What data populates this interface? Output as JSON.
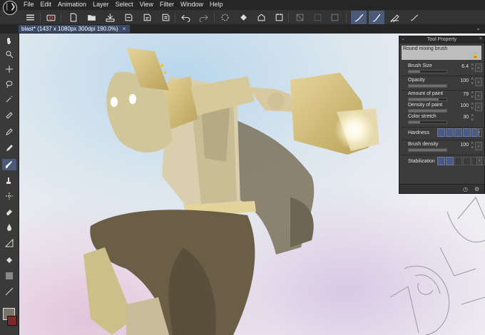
{
  "app": {
    "logo_glyph": "❘❯"
  },
  "menu": [
    "File",
    "Edit",
    "Animation",
    "Layer",
    "Select",
    "View",
    "Filter",
    "Window",
    "Help"
  ],
  "toolbar": {
    "icons": [
      "menu-icon",
      "camera-icon",
      "new-file-icon",
      "open-folder-icon",
      "save-icon",
      "export-icon",
      "export-png-icon",
      "export-jpg-icon",
      "undo-icon",
      "redo-icon",
      "loading-icon",
      "fill-bucket-icon",
      "crop-icon",
      "clear-selection-icon",
      "select-all-icon",
      "hide-selection-icon",
      "pen-pressure-icon",
      "brush-pressure-icon",
      "ruler-snap-icon",
      "tablet-mode-icon"
    ],
    "accent": "#4a5a78"
  },
  "document": {
    "tab_title": "blast* (1437 x 1080px 300dpi 190.0%)",
    "tab_close": "×",
    "overflow": "⌄"
  },
  "toolbox": {
    "tools": [
      "hand-icon",
      "zoom-icon",
      "move-icon",
      "lasso-icon",
      "magic-wand-icon",
      "eyedropper-icon",
      "pen-icon",
      "pencil-icon",
      "brush-icon",
      "airbrush-icon",
      "decoration-icon",
      "eraser-icon",
      "blend-icon",
      "transform-icon",
      "fill-icon",
      "gradient-icon",
      "line-icon",
      "text-icon"
    ],
    "active_index": 8,
    "main_color": "#7b7468",
    "sub_color": "#7b2a2a"
  },
  "tool_property": {
    "title": "Tool Property",
    "brush_name": "Round mixing brush",
    "rows": [
      {
        "label": "Brush Size",
        "value": "6.4",
        "fill": 0.3
      },
      {
        "label": "Opacity",
        "value": "100",
        "fill": 1.0
      },
      {
        "label": "Amount of paint",
        "value": "79",
        "fill": 0.79
      },
      {
        "label": "Density of paint",
        "value": "100",
        "fill": 1.0
      },
      {
        "label": "Color stretch",
        "value": "30",
        "fill": 0.3
      }
    ],
    "hardness": {
      "label": "Hardness",
      "level": 5,
      "of": 5
    },
    "brush_density": {
      "label": "Brush density",
      "value": "100",
      "fill": 1.0
    },
    "stabilization": {
      "label": "Stabilization",
      "level": 2,
      "of": 6
    }
  }
}
